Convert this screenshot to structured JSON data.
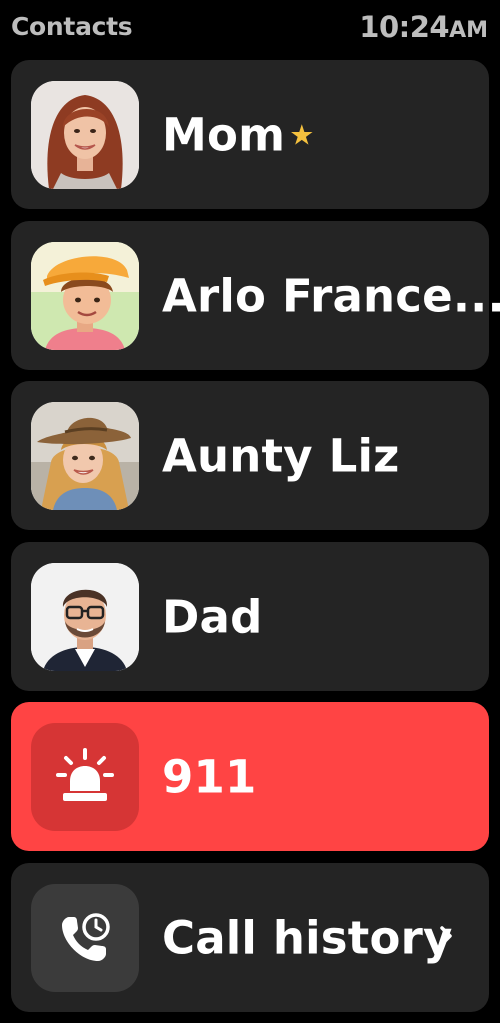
{
  "status_bar": {
    "title": "Contacts",
    "time": "10:24",
    "ampm": "AM"
  },
  "contacts": [
    {
      "name": "Mom",
      "favorite": true,
      "avatar": "woman-red-hair-avatar"
    },
    {
      "name": "Arlo France...",
      "favorite": false,
      "avatar": "boy-orange-cap-avatar"
    },
    {
      "name": "Aunty Liz",
      "favorite": false,
      "avatar": "girl-brown-hat-avatar"
    },
    {
      "name": "Dad",
      "favorite": false,
      "avatar": "man-glasses-beard-avatar"
    }
  ],
  "emergency": {
    "label": "911",
    "icon": "siren-icon"
  },
  "call_history": {
    "label": "Call history",
    "icon": "phone-clock-icon"
  },
  "colors": {
    "background": "#000000",
    "card": "#242424",
    "emergency": "#ff4444",
    "emergency_icon_tile": "#d63535",
    "star": "#f5c13e",
    "status_text": "#bdbdbd"
  }
}
